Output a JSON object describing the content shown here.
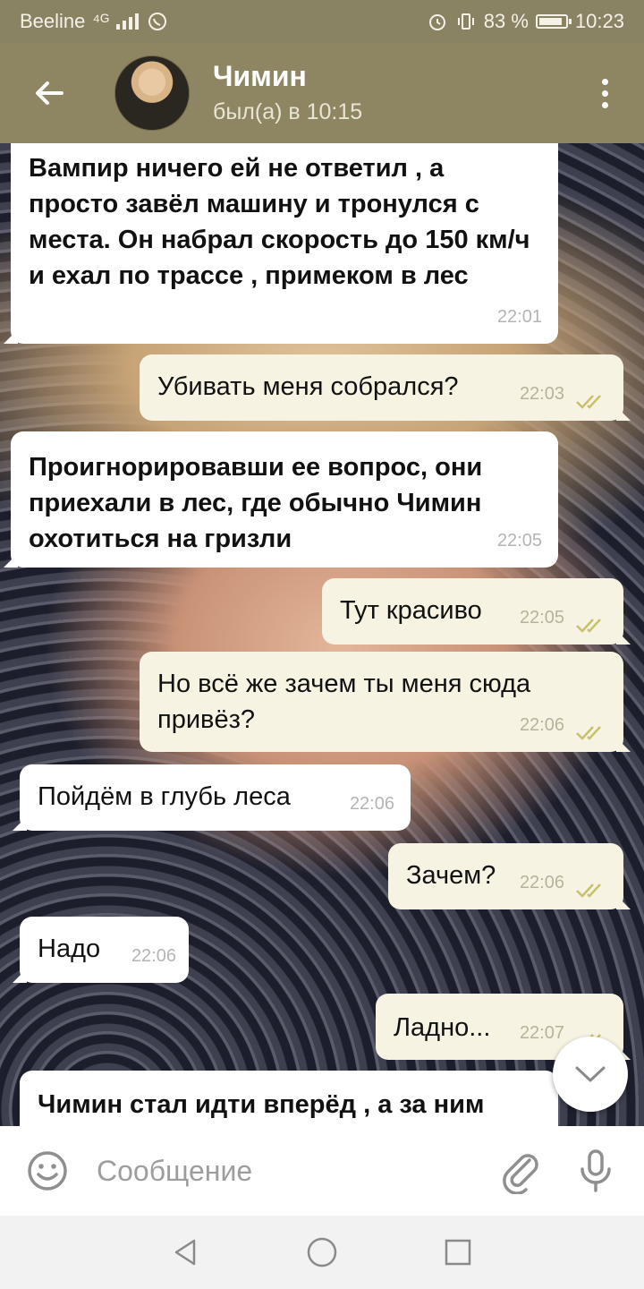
{
  "status_bar": {
    "carrier": "Beeline",
    "signal": "⁴ᴳ",
    "battery": "83 %",
    "time": "10:23"
  },
  "header": {
    "contact_name": "Чимин",
    "last_seen": "был(а) в 10:15"
  },
  "messages": [
    {
      "dir": "in",
      "text": "Вампир ничего ей не ответил , а просто завёл машину и тронулся с места. Он набрал скорость до 150 км/ч и ехал по трассе ,  примеком в лес",
      "time": "22:01"
    },
    {
      "dir": "out",
      "text": "Убивать меня собрался?",
      "time": "22:03"
    },
    {
      "dir": "in",
      "text": "Проигнорировавши ее вопрос, они приехали в лес, где обычно Чимин охотиться на гризли",
      "time": "22:05"
    },
    {
      "dir": "out",
      "text": "Тут красиво",
      "time": "22:05"
    },
    {
      "dir": "out",
      "text": "Но всё же зачем ты меня сюда привёз?",
      "time": "22:06"
    },
    {
      "dir": "in",
      "text": "Пойдём в глубь леса",
      "time": "22:06"
    },
    {
      "dir": "out",
      "text": "Зачем?",
      "time": "22:06"
    },
    {
      "dir": "in",
      "text": "Надо",
      "time": "22:06"
    },
    {
      "dir": "out",
      "text": "Ладно...",
      "time": "22:07"
    },
    {
      "dir": "in",
      "text": "Чимин стал идти вперёд , а за ним",
      "time": ""
    }
  ],
  "input": {
    "placeholder": "Сообщение"
  },
  "colors": {
    "header_bg": "#8e8663",
    "incoming_bubble": "#ffffff",
    "outgoing_bubble": "#f7f3e3",
    "read_ticks": "#c9bf6a"
  },
  "icons": [
    "arrow-back-icon",
    "more-vert-icon",
    "double-check-icon",
    "chevron-down-icon",
    "emoji-icon",
    "paperclip-icon",
    "microphone-icon",
    "nav-back-icon",
    "nav-home-icon",
    "nav-recents-icon"
  ]
}
